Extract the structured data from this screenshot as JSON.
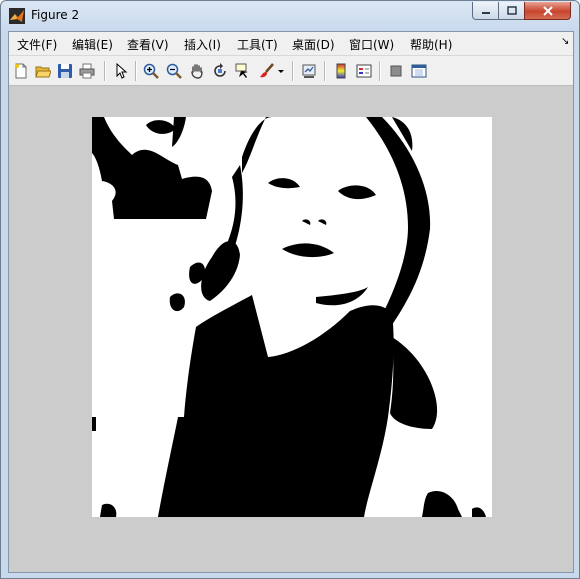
{
  "window": {
    "title": "Figure 2"
  },
  "menu": {
    "items": [
      {
        "id": "file",
        "label": "文件(F)"
      },
      {
        "id": "edit",
        "label": "编辑(E)"
      },
      {
        "id": "view",
        "label": "查看(V)"
      },
      {
        "id": "insert",
        "label": "插入(I)"
      },
      {
        "id": "tools",
        "label": "工具(T)"
      },
      {
        "id": "desktop",
        "label": "桌面(D)"
      },
      {
        "id": "window",
        "label": "窗口(W)"
      },
      {
        "id": "help",
        "label": "帮助(H)"
      }
    ]
  },
  "toolbar": {
    "icons": [
      "new-figure-icon",
      "open-file-icon",
      "save-icon",
      "print-icon",
      "edit-plot-arrow-icon",
      "zoom-in-icon",
      "zoom-out-icon",
      "pan-hand-icon",
      "rotate-3d-icon",
      "data-cursor-icon",
      "brush-icon",
      "link-plot-icon",
      "colorbar-icon",
      "legend-icon",
      "hide-plot-tools-icon",
      "show-plot-tools-icon"
    ]
  },
  "figure": {
    "content": "binary black and white photograph"
  },
  "colors": {
    "figure_background": "#cccccc",
    "close_button": "#c7452d"
  }
}
